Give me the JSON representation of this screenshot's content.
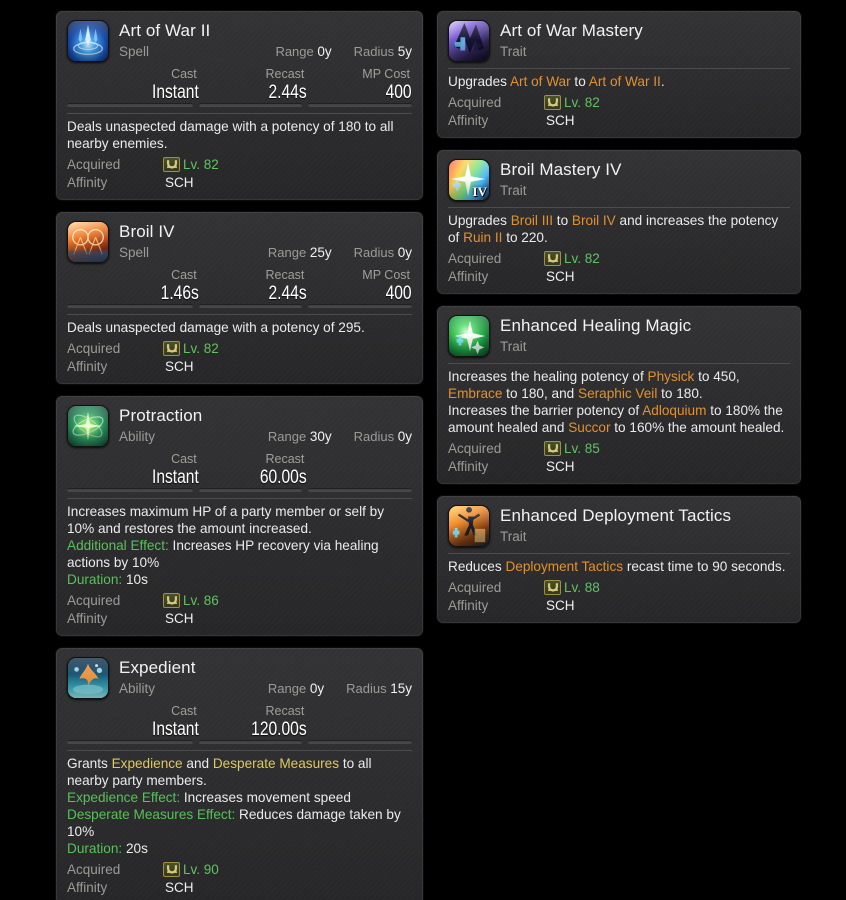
{
  "colors": {
    "background": "#000000",
    "card_bg": "#2e2e30",
    "text": "#ebebeb",
    "label": "#9b9b96",
    "level_green": "#61c261",
    "link_orange": "#e3912e",
    "status_gold": "#ddc95d",
    "effect_green": "#57c257"
  },
  "labels": {
    "cast": "Cast",
    "recast": "Recast",
    "mp_cost": "MP Cost",
    "range": "Range",
    "radius": "Radius",
    "acquired": "Acquired",
    "affinity": "Affinity"
  },
  "left_column": [
    {
      "name": "Art of War II",
      "kind": "Spell",
      "icon": "art-of-war-ii-icon",
      "range": "0y",
      "radius": "5y",
      "cast": "Instant",
      "recast": "2.44s",
      "mp_cost": "400",
      "description": "Deals unaspected damage with a potency of 180 to all nearby enemies.",
      "acquired_level": "Lv. 82",
      "affinity": "SCH"
    },
    {
      "name": "Broil IV",
      "kind": "Spell",
      "icon": "broil-iv-icon",
      "range": "25y",
      "radius": "0y",
      "cast": "1.46s",
      "recast": "2.44s",
      "mp_cost": "400",
      "description": "Deals unaspected damage with a potency of 295.",
      "acquired_level": "Lv. 82",
      "affinity": "SCH"
    },
    {
      "name": "Protraction",
      "kind": "Ability",
      "icon": "protraction-icon",
      "range": "30y",
      "radius": "0y",
      "cast": "Instant",
      "recast": "60.00s",
      "mp_cost": "",
      "description": "Increases maximum HP of a party member or self by 10% and restores the amount increased.",
      "effects": [
        {
          "label": "Additional Effect:",
          "label_color": "green",
          "text": " Increases HP recovery via healing actions by 10%"
        },
        {
          "label": "Duration:",
          "label_color": "green",
          "text": " 10s"
        }
      ],
      "acquired_level": "Lv. 86",
      "affinity": "SCH"
    },
    {
      "name": "Expedient",
      "kind": "Ability",
      "icon": "expedient-icon",
      "range": "0y",
      "radius": "15y",
      "cast": "Instant",
      "recast": "120.00s",
      "mp_cost": "",
      "description_parts": [
        {
          "text": "Grants ",
          "color": ""
        },
        {
          "text": "Expedience",
          "color": "gold"
        },
        {
          "text": " and ",
          "color": ""
        },
        {
          "text": "Desperate Measures",
          "color": "gold"
        },
        {
          "text": " to all nearby party members.",
          "color": ""
        }
      ],
      "effects": [
        {
          "label": "Expedience Effect:",
          "label_color": "green",
          "text": " Increases movement speed"
        },
        {
          "label": "Desperate Measures Effect:",
          "label_color": "green",
          "text": " Reduces damage taken by 10%"
        },
        {
          "label": "Duration:",
          "label_color": "green",
          "text": " 20s"
        }
      ],
      "acquired_level": "Lv. 90",
      "affinity": "SCH"
    }
  ],
  "right_column": [
    {
      "name": "Art of War Mastery",
      "kind": "Trait",
      "icon": "art-of-war-mastery-icon",
      "description_parts": [
        {
          "text": "Upgrades ",
          "color": ""
        },
        {
          "text": "Art of War",
          "color": "orange"
        },
        {
          "text": " to ",
          "color": ""
        },
        {
          "text": "Art of War II",
          "color": "orange"
        },
        {
          "text": ".",
          "color": ""
        }
      ],
      "acquired_level": "Lv. 82",
      "affinity": "SCH"
    },
    {
      "name": "Broil Mastery IV",
      "kind": "Trait",
      "icon": "broil-mastery-iv-icon",
      "icon_badge": "IV",
      "description_parts": [
        {
          "text": "Upgrades ",
          "color": ""
        },
        {
          "text": "Broil III",
          "color": "orange"
        },
        {
          "text": " to ",
          "color": ""
        },
        {
          "text": "Broil IV",
          "color": "orange"
        },
        {
          "text": " and increases the potency of ",
          "color": ""
        },
        {
          "text": "Ruin II",
          "color": "orange"
        },
        {
          "text": " to 220.",
          "color": ""
        }
      ],
      "acquired_level": "Lv. 82",
      "affinity": "SCH"
    },
    {
      "name": "Enhanced Healing Magic",
      "kind": "Trait",
      "icon": "enhanced-healing-magic-icon",
      "description_parts": [
        {
          "text": "Increases the healing potency of ",
          "color": ""
        },
        {
          "text": "Physick",
          "color": "orange"
        },
        {
          "text": " to 450, ",
          "color": ""
        },
        {
          "text": "Embrace",
          "color": "orange"
        },
        {
          "text": " to 180, and ",
          "color": ""
        },
        {
          "text": "Seraphic Veil",
          "color": "orange"
        },
        {
          "text": " to 180.",
          "color": ""
        },
        {
          "text": "\nIncreases the barrier potency of ",
          "color": ""
        },
        {
          "text": "Adloquium",
          "color": "orange"
        },
        {
          "text": " to 180% the amount healed and ",
          "color": ""
        },
        {
          "text": "Succor",
          "color": "orange"
        },
        {
          "text": " to 160% the amount healed.",
          "color": ""
        }
      ],
      "acquired_level": "Lv. 85",
      "affinity": "SCH"
    },
    {
      "name": "Enhanced Deployment Tactics",
      "kind": "Trait",
      "icon": "enhanced-deployment-tactics-icon",
      "description_parts": [
        {
          "text": "Reduces ",
          "color": ""
        },
        {
          "text": "Deployment Tactics",
          "color": "orange"
        },
        {
          "text": " recast time to 90 seconds.",
          "color": ""
        }
      ],
      "acquired_level": "Lv. 88",
      "affinity": "SCH"
    }
  ]
}
